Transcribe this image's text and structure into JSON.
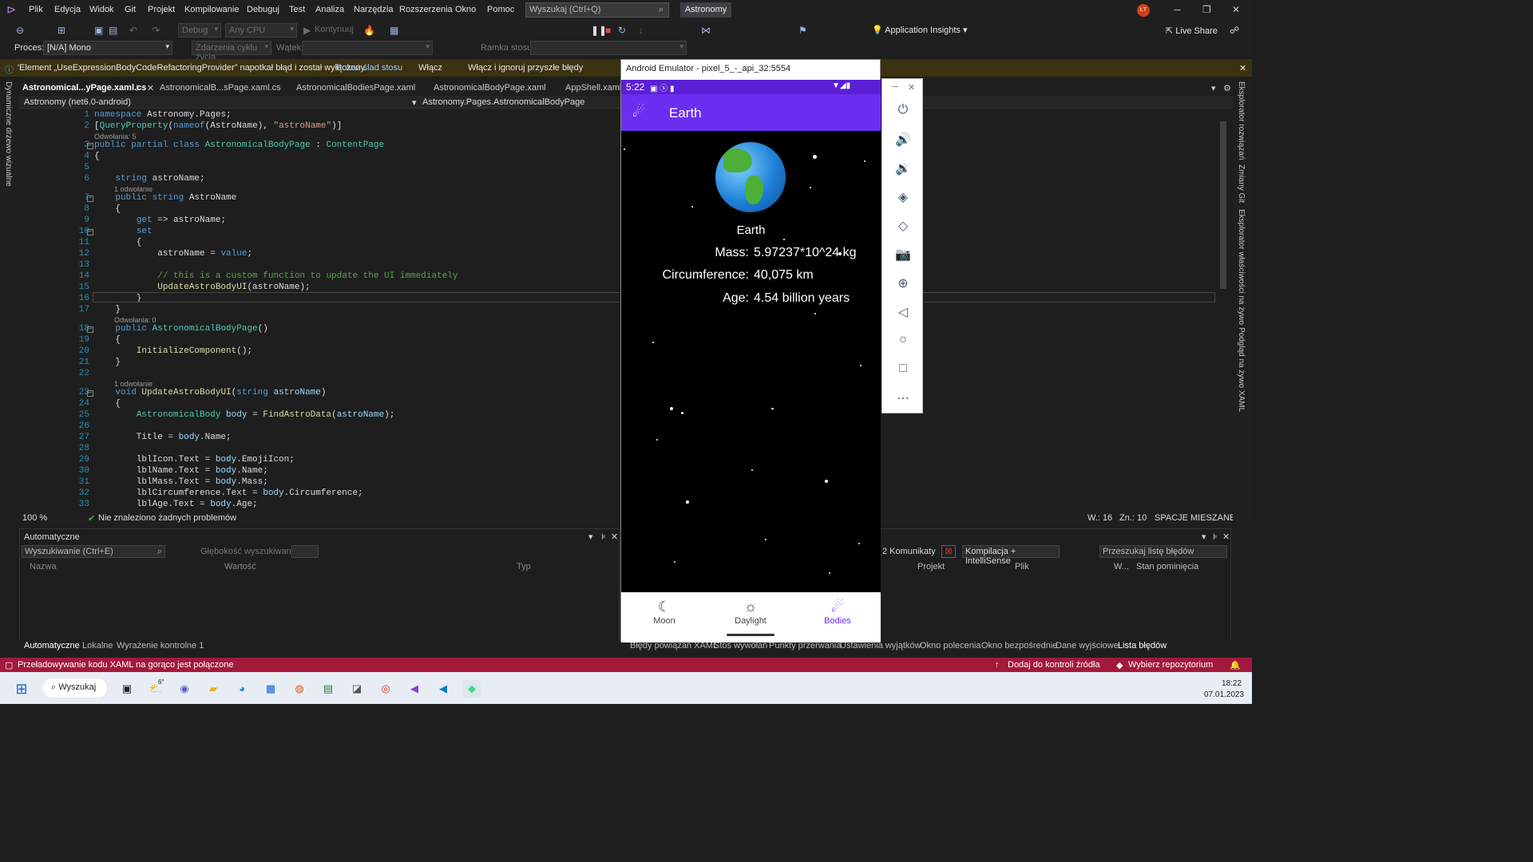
{
  "menu": [
    "Plik",
    "Edycja",
    "Widok",
    "Git",
    "Projekt",
    "Kompilowanie",
    "Debuguj",
    "Test",
    "Analiza",
    "Narzędzia",
    "Rozszerzenia",
    "Okno",
    "Pomoc"
  ],
  "search_placeholder": "Wyszukaj (Ctrl+Q)",
  "solution_name": "Astronomy",
  "avatar_initials": "ŁT",
  "toolbar": {
    "config": "Debug",
    "platform": "Any CPU",
    "continue": "Kontynuuj",
    "app_insights": "Application Insights",
    "live_share": "Live Share"
  },
  "procbar": {
    "process_label": "Proces:",
    "process_value": "[N/A] Mono",
    "lifecycle": "Zdarzenia cyklu życia",
    "thread": "Wątek:",
    "stack": "Ramka stosu:"
  },
  "infobar": {
    "message": "'Element „UseExpressionBodyCodeRefactoringProvider” napotkał błąd i został wyłączony.",
    "link1": "Pokaż ślad stosu",
    "link2": "Włącz",
    "link3": "Włącz i ignoruj przyszłe błędy"
  },
  "left_strip": "Dynamiczne drzewo wizualne",
  "right_strip": [
    "Eksplorator rozwiązań",
    "Zmiany Git",
    "Eksplorator właściwości na żywo",
    "Podgląd na żywo XAML"
  ],
  "tabs": [
    "Astronomical...yPage.xaml.cs",
    "AstronomicalB...sPage.xaml.cs",
    "AstronomicalBodiesPage.xaml",
    "AstronomicalBodyPage.xaml",
    "AppShell.xaml"
  ],
  "nav": {
    "project": "Astronomy (net6.0-android)",
    "member": "Astronomy.Pages.AstronomicalBodyPage"
  },
  "lenses": {
    "l3": "Odwołania: 5",
    "l7": "1 odwołanie",
    "l18": "Odwołania: 0",
    "l23": "1 odwołanie"
  },
  "editor_status": {
    "zoom": "100 %",
    "problems": "Nie znaleziono żadnych problemów",
    "line": "W.: 16",
    "col": "Zn.: 10",
    "spaces": "SPACJE",
    "eol": "MIESZANE"
  },
  "autos": {
    "title": "Automatyczne",
    "search": "Wyszukiwanie (Ctrl+E)",
    "depth": "Głębokość wyszukiwania:",
    "cols": [
      "Nazwa",
      "Wartość",
      "Typ"
    ]
  },
  "errors": {
    "messages": "2 Komunikaty",
    "filter": "Kompilacja + IntelliSense",
    "search": "Przeszukaj listę błędów",
    "cols": [
      "Projekt",
      "Plik",
      "W...",
      "Stan pominięcia"
    ]
  },
  "bottom_tabs_left": [
    "Automatyczne",
    "Lokalne",
    "Wyrażenie kontrolne 1"
  ],
  "bottom_tabs_right": [
    "Błędy powiązań XAML",
    "Stos wywołań",
    "Punkty przerwania",
    "Ustawienia wyjątków",
    "Okno polecenia",
    "Okno bezpośrednie",
    "Dane wyjściowe",
    "Lista błędów"
  ],
  "emulator": {
    "window_title": "Android Emulator - pixel_5_-_api_32:5554",
    "time": "5:22",
    "app_title": "Earth",
    "body_name": "Earth",
    "mass_label": "Mass:",
    "mass_value": "5.97237*10^24 kg",
    "circ_label": "Circumference:",
    "circ_value": "40,075 km",
    "age_label": "Age:",
    "age_value": "4.54 billion years",
    "nav": [
      "Moon",
      "Daylight",
      "Bodies"
    ]
  },
  "status_line": {
    "message": "Przeładowywanie kodu XAML na gorąco jest połączone",
    "source_control": "Dodaj do kontroli źródła",
    "repo": "Wybierz repozytorium"
  },
  "taskbar": {
    "search": "Wyszukaj",
    "time": "18:22",
    "date": "07.01.2023",
    "weather": "6°"
  }
}
